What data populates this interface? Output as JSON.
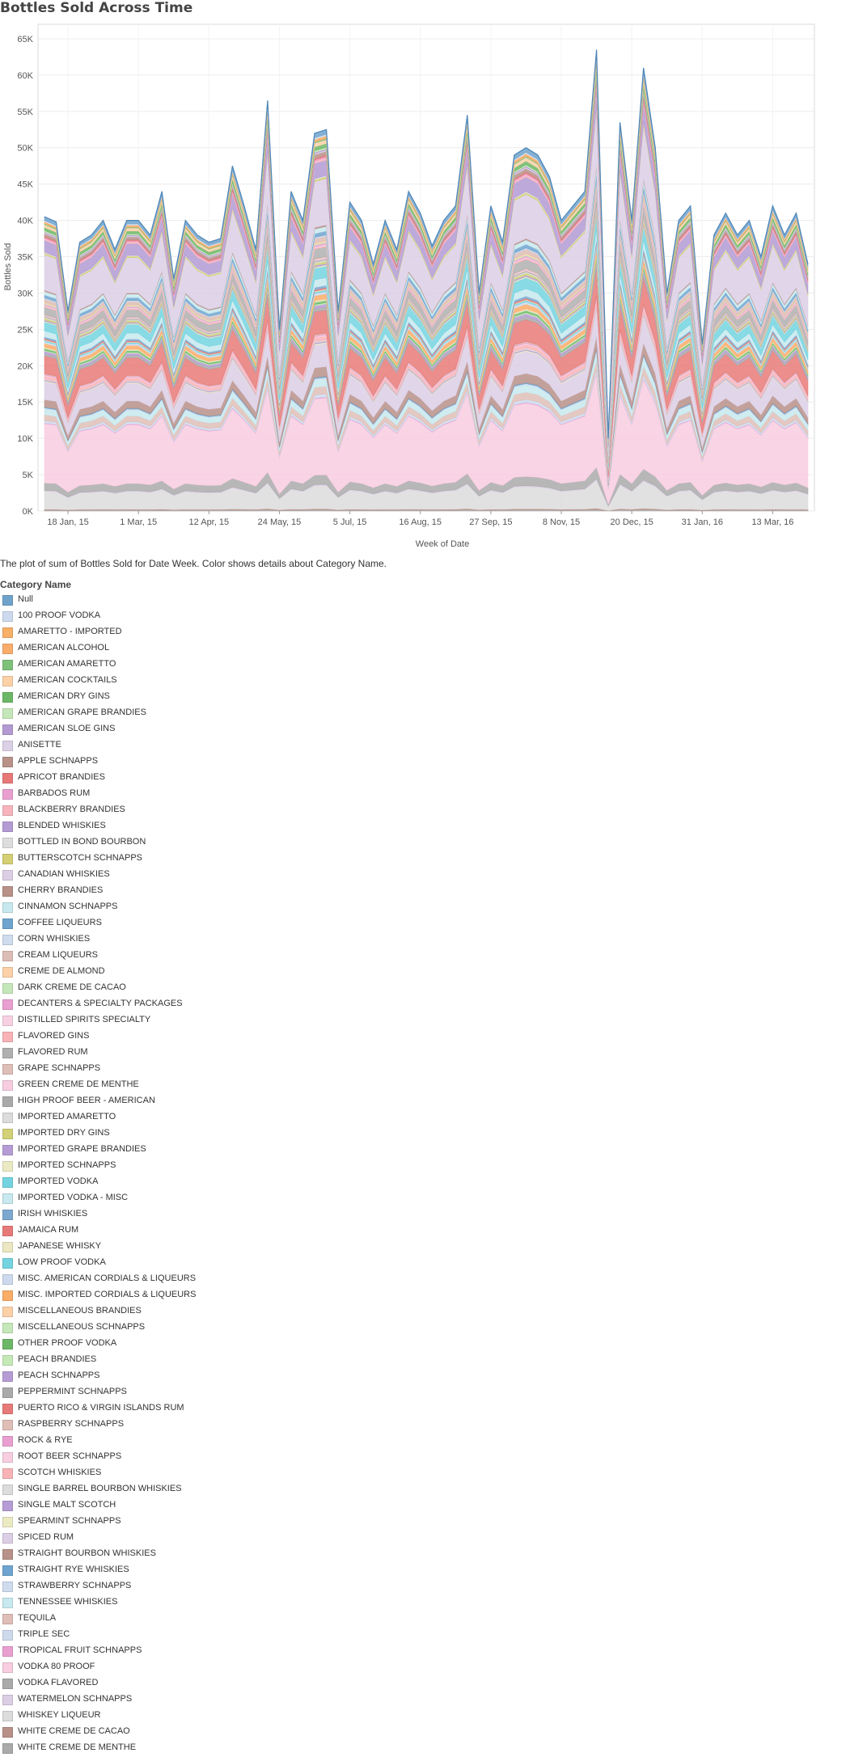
{
  "title": "Bottles Sold Across Time",
  "caption": "The plot of sum of Bottles Sold for Date Week.  Color shows details about Category Name.",
  "legend_title": "Category Name",
  "chart_data": {
    "type": "area",
    "stacked": true,
    "title": "Bottles Sold Across Time",
    "xlabel": "Week of Date",
    "ylabel": "Bottles Sold",
    "ylim": [
      0,
      67000
    ],
    "y_ticks": [
      "0K",
      "5K",
      "10K",
      "15K",
      "20K",
      "25K",
      "30K",
      "35K",
      "40K",
      "45K",
      "50K",
      "55K",
      "60K",
      "65K"
    ],
    "y_tick_values": [
      0,
      5000,
      10000,
      15000,
      20000,
      25000,
      30000,
      35000,
      40000,
      45000,
      50000,
      55000,
      60000,
      65000
    ],
    "x_ticks": [
      "18 Jan, 15",
      "1 Mar, 15",
      "12 Apr, 15",
      "24 May, 15",
      "5 Jul, 15",
      "16 Aug, 15",
      "27 Sep, 15",
      "8 Nov, 15",
      "20 Dec, 15",
      "31 Jan, 16",
      "13 Mar, 16"
    ],
    "x_tick_weeks": [
      2,
      8,
      14,
      20,
      26,
      32,
      38,
      44,
      50,
      56,
      62
    ],
    "grid": true,
    "legend_position": "bottom",
    "week_count": 66,
    "totals": [
      40500,
      39800,
      27500,
      37000,
      38000,
      40000,
      36000,
      40000,
      40000,
      38000,
      44000,
      32000,
      40000,
      38000,
      37000,
      37500,
      47500,
      42000,
      36000,
      56500,
      25000,
      44000,
      40000,
      52000,
      52500,
      27500,
      42500,
      40000,
      34000,
      40000,
      36000,
      44000,
      41000,
      36500,
      40000,
      42000,
      54500,
      30000,
      42000,
      37000,
      49000,
      50000,
      49000,
      46000,
      40000,
      42000,
      44000,
      63500,
      10000,
      53500,
      40000,
      61000,
      50000,
      30000,
      40000,
      42000,
      23000,
      38000,
      41000,
      38000,
      40000,
      35000,
      42000,
      38000,
      41000,
      34000
    ],
    "series": [
      {
        "name": "Null",
        "share": 0.012,
        "color": "#6fa3cc"
      },
      {
        "name": "100 PROOF VODKA",
        "share": 0.004,
        "color": "#cddaee"
      },
      {
        "name": "AMARETTO - IMPORTED",
        "share": 0.004,
        "color": "#f9b067"
      },
      {
        "name": "AMERICAN ALCOHOL",
        "share": 0.003,
        "color": "#fbac6b"
      },
      {
        "name": "AMERICAN AMARETTO",
        "share": 0.003,
        "color": "#7ec17a"
      },
      {
        "name": "AMERICAN COCKTAILS",
        "share": 0.01,
        "color": "#fdd1a8"
      },
      {
        "name": "AMERICAN DRY GINS",
        "share": 0.01,
        "color": "#6cb766"
      },
      {
        "name": "AMERICAN GRAPE BRANDIES",
        "share": 0.004,
        "color": "#c5e7b9"
      },
      {
        "name": "AMERICAN SLOE GINS",
        "share": 0.003,
        "color": "#b39ad2"
      },
      {
        "name": "ANISETTE",
        "share": 0.003,
        "color": "#dcd0e6"
      },
      {
        "name": "APPLE SCHNAPPS",
        "share": 0.01,
        "color": "#b89189"
      },
      {
        "name": "APRICOT BRANDIES",
        "share": 0.004,
        "color": "#e87878"
      },
      {
        "name": "BARBADOS RUM",
        "share": 0.003,
        "color": "#ea9fd1"
      },
      {
        "name": "BLACKBERRY BRANDIES",
        "share": 0.006,
        "color": "#f8b4bd"
      },
      {
        "name": "BLENDED WHISKIES",
        "share": 0.04,
        "color": "#b39bd3"
      },
      {
        "name": "BOTTLED IN BOND BOURBON",
        "share": 0.003,
        "color": "#dddddd"
      },
      {
        "name": "BUTTERSCOTCH SCHNAPPS",
        "share": 0.005,
        "color": "#d4d073"
      },
      {
        "name": "CANADIAN WHISKIES",
        "share": 0.12,
        "color": "#dccfe5"
      },
      {
        "name": "CHERRY BRANDIES",
        "share": 0.004,
        "color": "#b89189"
      },
      {
        "name": "CINNAMON SCHNAPPS",
        "share": 0.012,
        "color": "#c7e9ef"
      },
      {
        "name": "COFFEE LIQUEURS",
        "share": 0.01,
        "color": "#6ea4cf"
      },
      {
        "name": "CORN WHISKIES",
        "share": 0.003,
        "color": "#cfdcef"
      },
      {
        "name": "CREAM LIQUEURS",
        "share": 0.012,
        "color": "#dcbdb5"
      },
      {
        "name": "CREME DE ALMOND",
        "share": 0.003,
        "color": "#fdd1a8"
      },
      {
        "name": "DARK CREME DE CACAO",
        "share": 0.003,
        "color": "#c5e7b9"
      },
      {
        "name": "DECANTERS & SPECIALTY PACKAGES",
        "share": 0.004,
        "color": "#ea9fd1"
      },
      {
        "name": "DISTILLED SPIRITS SPECIALTY",
        "share": 0.003,
        "color": "#f7d1e2"
      },
      {
        "name": "FLAVORED GINS",
        "share": 0.003,
        "color": "#f9b3b7"
      },
      {
        "name": "FLAVORED RUM",
        "share": 0.025,
        "color": "#b0b0b0"
      },
      {
        "name": "GRAPE SCHNAPPS",
        "share": 0.003,
        "color": "#dfbeb7"
      },
      {
        "name": "GREEN CREME DE MENTHE",
        "share": 0.003,
        "color": "#f8cde0"
      },
      {
        "name": "HIGH PROOF BEER - AMERICAN",
        "share": 0.003,
        "color": "#aaaaaa"
      },
      {
        "name": "IMPORTED AMARETTO",
        "share": 0.003,
        "color": "#dcdcdc"
      },
      {
        "name": "IMPORTED DRY GINS",
        "share": 0.006,
        "color": "#d2d177"
      },
      {
        "name": "IMPORTED GRAPE BRANDIES",
        "share": 0.004,
        "color": "#b69cd4"
      },
      {
        "name": "IMPORTED SCHNAPPS",
        "share": 0.003,
        "color": "#ebeac3"
      },
      {
        "name": "IMPORTED VODKA",
        "share": 0.03,
        "color": "#73d4e0"
      },
      {
        "name": "IMPORTED VODKA - MISC",
        "share": 0.02,
        "color": "#c7e9ef"
      },
      {
        "name": "IRISH WHISKIES",
        "share": 0.006,
        "color": "#7da8d0"
      },
      {
        "name": "JAMAICA RUM",
        "share": 0.004,
        "color": "#e77a78"
      },
      {
        "name": "JAPANESE WHISKY",
        "share": 0.002,
        "color": "#ebe7c0"
      },
      {
        "name": "LOW PROOF VODKA",
        "share": 0.004,
        "color": "#73d4e0"
      },
      {
        "name": "MISC. AMERICAN CORDIALS & LIQUEURS",
        "share": 0.006,
        "color": "#cddaee"
      },
      {
        "name": "MISC. IMPORTED CORDIALS & LIQUEURS",
        "share": 0.012,
        "color": "#fbac67"
      },
      {
        "name": "MISCELLANEOUS  BRANDIES",
        "share": 0.003,
        "color": "#fdd1a8"
      },
      {
        "name": "MISCELLANEOUS SCHNAPPS",
        "share": 0.003,
        "color": "#c5e7b9"
      },
      {
        "name": "OTHER PROOF VODKA",
        "share": 0.005,
        "color": "#6cb766"
      },
      {
        "name": "PEACH BRANDIES",
        "share": 0.003,
        "color": "#c5e9b6"
      },
      {
        "name": "PEACH SCHNAPPS",
        "share": 0.008,
        "color": "#b69cd4"
      },
      {
        "name": "PEPPERMINT SCHNAPPS",
        "share": 0.008,
        "color": "#aaaaaa"
      },
      {
        "name": "PUERTO RICO & VIRGIN ISLANDS RUM",
        "share": 0.06,
        "color": "#e77a78"
      },
      {
        "name": "RASPBERRY SCHNAPPS",
        "share": 0.003,
        "color": "#dfbeb7"
      },
      {
        "name": "ROCK & RYE",
        "share": 0.002,
        "color": "#ea9fd1"
      },
      {
        "name": "ROOT BEER SCHNAPPS",
        "share": 0.003,
        "color": "#f8cde0"
      },
      {
        "name": "SCOTCH WHISKIES",
        "share": 0.01,
        "color": "#f9b3b7"
      },
      {
        "name": "SINGLE BARREL BOURBON WHISKIES",
        "share": 0.003,
        "color": "#dcdcdc"
      },
      {
        "name": "SINGLE MALT SCOTCH",
        "share": 0.003,
        "color": "#b69cd4"
      },
      {
        "name": "SPEARMINT SCHNAPPS",
        "share": 0.003,
        "color": "#ebeac3"
      },
      {
        "name": "SPICED RUM",
        "share": 0.06,
        "color": "#dccfe5"
      },
      {
        "name": "STRAIGHT BOURBON WHISKIES",
        "share": 0.025,
        "color": "#b89189"
      },
      {
        "name": "STRAIGHT RYE WHISKIES",
        "share": 0.003,
        "color": "#6ea4cf"
      },
      {
        "name": "STRAWBERRY SCHNAPPS",
        "share": 0.003,
        "color": "#cfdcef"
      },
      {
        "name": "TENNESSEE WHISKIES",
        "share": 0.02,
        "color": "#c7e9ef"
      },
      {
        "name": "TEQUILA",
        "share": 0.02,
        "color": "#dfbeb7"
      },
      {
        "name": "TRIPLE SEC",
        "share": 0.008,
        "color": "#cddaee"
      },
      {
        "name": "TROPICAL FRUIT SCHNAPPS",
        "share": 0.002,
        "color": "#ea9fd1"
      },
      {
        "name": "VODKA 80 PROOF",
        "share": 0.2,
        "color": "#f8cde0"
      },
      {
        "name": "VODKA FLAVORED",
        "share": 0.025,
        "color": "#aaaaaa"
      },
      {
        "name": "WATERMELON SCHNAPPS",
        "share": 0.003,
        "color": "#dccfe5"
      },
      {
        "name": "WHISKEY LIQUEUR",
        "share": 0.06,
        "color": "#dcdcdc"
      },
      {
        "name": "WHITE CREME DE CACAO",
        "share": 0.003,
        "color": "#b89189"
      },
      {
        "name": "WHITE CREME DE MENTHE",
        "share": 0.003,
        "color": "#aaaaaa"
      }
    ]
  }
}
